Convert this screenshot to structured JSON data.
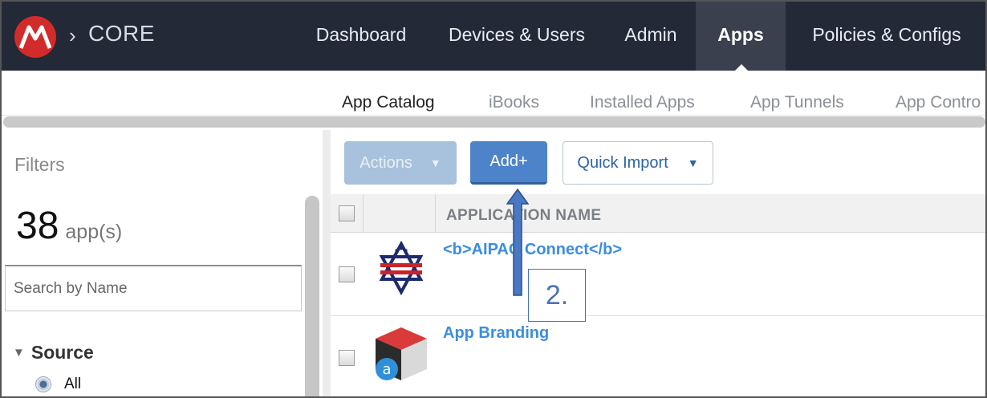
{
  "header": {
    "brand": "CORE",
    "crumb_separator": "›",
    "nav": [
      "Dashboard",
      "Devices & Users",
      "Admin",
      "Apps",
      "Policies & Configs"
    ],
    "active_nav": "Apps"
  },
  "subnav": {
    "items": [
      "App Catalog",
      "iBooks",
      "Installed Apps",
      "App Tunnels",
      "App Contro"
    ],
    "active": "App Catalog"
  },
  "sidebar": {
    "title": "Filters",
    "app_count": "38",
    "app_count_unit": "app(s)",
    "search_placeholder": "Search by Name",
    "source_label": "Source",
    "source_options": [
      "All"
    ]
  },
  "toolbar": {
    "actions_label": "Actions",
    "add_label": "Add+",
    "quick_import_label": "Quick Import"
  },
  "table": {
    "column_header": "APPLICATION NAME",
    "rows": [
      {
        "name": "<b>AIPAC Connect</b>"
      },
      {
        "name": "App Branding"
      }
    ]
  },
  "annotation": {
    "label": "2."
  },
  "colors": {
    "nav_bg": "#232936",
    "nav_active_bg": "#3a404d",
    "logo_red": "#d22b2b",
    "primary_button": "#4d84c9",
    "disabled_button": "#a8c1dc",
    "link_blue": "#3d8de0",
    "annotation_blue": "#4a72b8"
  },
  "icons": {
    "logo": "mobileiron-logo-icon",
    "aipac": "star-of-david-flag-icon",
    "branding": "red-cube-a-icon",
    "arrow": "up-arrow-annotation-icon"
  }
}
